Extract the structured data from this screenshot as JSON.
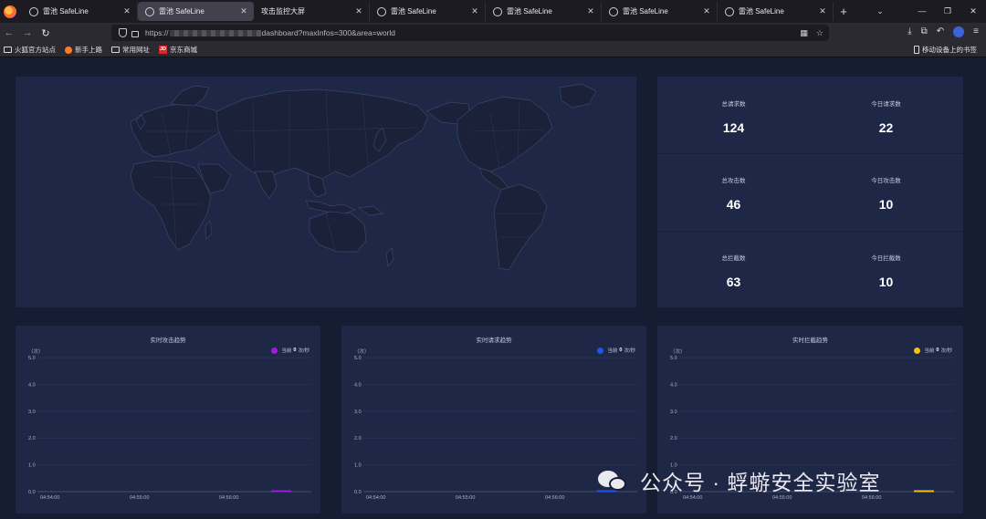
{
  "browser": {
    "tabs": [
      {
        "title": "雷池 SafeLine",
        "active": false
      },
      {
        "title": "雷池 SafeLine",
        "active": true
      },
      {
        "title": "攻击监控大屏",
        "active": false
      },
      {
        "title": "雷池 SafeLine",
        "active": false
      },
      {
        "title": "雷池 SafeLine",
        "active": false
      },
      {
        "title": "雷池 SafeLine",
        "active": false
      },
      {
        "title": "雷池 SafeLine",
        "active": false
      }
    ],
    "url_prefix": "https://",
    "url_suffix": "dashboard?maxInfos=300&area=world",
    "bookmarks": [
      "火狐官方站点",
      "新手上路",
      "常用网址",
      "京东商城"
    ],
    "bookmark_mobile": "移动设备上的书签",
    "jd_badge": "JD"
  },
  "stats": [
    {
      "label": "总请求数",
      "value": "124"
    },
    {
      "label": "今日请求数",
      "value": "22"
    },
    {
      "label": "总攻击数",
      "value": "46"
    },
    {
      "label": "今日攻击数",
      "value": "10"
    },
    {
      "label": "总拦截数",
      "value": "63"
    },
    {
      "label": "今日拦截数",
      "value": "10"
    }
  ],
  "chart_data": [
    {
      "type": "line",
      "title": "实时攻击趋势",
      "ylabel": "（次）",
      "legend": {
        "prefix": "当前",
        "current": "0",
        "suffix": "次/秒",
        "color": "#a21bd8",
        "position": "top-right"
      },
      "yticks": [
        "5.0",
        "4.0",
        "3.0",
        "2.0",
        "1.0",
        "0.0"
      ],
      "ylim": [
        0,
        5
      ],
      "xticks": [
        "04:54:00",
        "04:55:00",
        "04:56:00"
      ],
      "series": [
        {
          "values": [
            0
          ]
        }
      ]
    },
    {
      "type": "line",
      "title": "实时请求趋势",
      "ylabel": "（次）",
      "legend": {
        "prefix": "当前",
        "current": "0",
        "suffix": "次/秒",
        "color": "#1d56e8",
        "position": "top-right"
      },
      "yticks": [
        "5.0",
        "4.0",
        "3.0",
        "2.0",
        "1.0",
        "0.0"
      ],
      "ylim": [
        0,
        5
      ],
      "xticks": [
        "04:54:00",
        "04:55:00",
        "04:56:00"
      ],
      "series": [
        {
          "values": [
            0
          ]
        }
      ]
    },
    {
      "type": "line",
      "title": "实时拦截趋势",
      "ylabel": "（次）",
      "legend": {
        "prefix": "当前",
        "current": "0",
        "suffix": "次/秒",
        "color": "#f2c20c",
        "position": "top-right"
      },
      "yticks": [
        "5.0",
        "4.0",
        "3.0",
        "2.0",
        "1.0",
        "0.0"
      ],
      "ylim": [
        0,
        5
      ],
      "xticks": [
        "04:54:00",
        "04:55:00",
        "04:56:00"
      ],
      "series": [
        {
          "values": [
            0
          ]
        }
      ]
    }
  ],
  "watermark": {
    "text": "公众号 · 蜉蝣安全实验室"
  }
}
